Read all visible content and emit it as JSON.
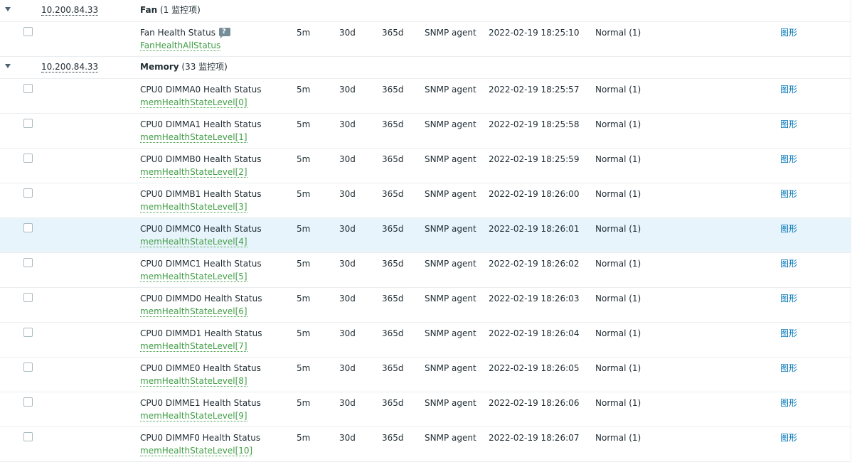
{
  "groups": [
    {
      "host": "10.200.84.33",
      "app_name": "Fan",
      "app_count": "(1 监控项)",
      "items": [
        {
          "name": "Fan Health Status",
          "help": true,
          "key": "FanHealthAllStatus",
          "interval": "5m",
          "history": "30d",
          "trends": "365d",
          "type": "SNMP agent",
          "last_check": "2022-02-19 18:25:10",
          "last_value": "Normal (1)",
          "graph": "图形"
        }
      ]
    },
    {
      "host": "10.200.84.33",
      "app_name": "Memory",
      "app_count": "(33 监控项)",
      "items": [
        {
          "name": "CPU0 DIMMA0 Health Status",
          "key": "memHealthStateLevel[0]",
          "interval": "5m",
          "history": "30d",
          "trends": "365d",
          "type": "SNMP agent",
          "last_check": "2022-02-19 18:25:57",
          "last_value": "Normal (1)",
          "graph": "图形"
        },
        {
          "name": "CPU0 DIMMA1 Health Status",
          "key": "memHealthStateLevel[1]",
          "interval": "5m",
          "history": "30d",
          "trends": "365d",
          "type": "SNMP agent",
          "last_check": "2022-02-19 18:25:58",
          "last_value": "Normal (1)",
          "graph": "图形"
        },
        {
          "name": "CPU0 DIMMB0 Health Status",
          "key": "memHealthStateLevel[2]",
          "interval": "5m",
          "history": "30d",
          "trends": "365d",
          "type": "SNMP agent",
          "last_check": "2022-02-19 18:25:59",
          "last_value": "Normal (1)",
          "graph": "图形"
        },
        {
          "name": "CPU0 DIMMB1 Health Status",
          "key": "memHealthStateLevel[3]",
          "interval": "5m",
          "history": "30d",
          "trends": "365d",
          "type": "SNMP agent",
          "last_check": "2022-02-19 18:26:00",
          "last_value": "Normal (1)",
          "graph": "图形"
        },
        {
          "name": "CPU0 DIMMC0 Health Status",
          "key": "memHealthStateLevel[4]",
          "interval": "5m",
          "history": "30d",
          "trends": "365d",
          "type": "SNMP agent",
          "last_check": "2022-02-19 18:26:01",
          "last_value": "Normal (1)",
          "graph": "图形",
          "hover": true
        },
        {
          "name": "CPU0 DIMMC1 Health Status",
          "key": "memHealthStateLevel[5]",
          "interval": "5m",
          "history": "30d",
          "trends": "365d",
          "type": "SNMP agent",
          "last_check": "2022-02-19 18:26:02",
          "last_value": "Normal (1)",
          "graph": "图形"
        },
        {
          "name": "CPU0 DIMMD0 Health Status",
          "key": "memHealthStateLevel[6]",
          "interval": "5m",
          "history": "30d",
          "trends": "365d",
          "type": "SNMP agent",
          "last_check": "2022-02-19 18:26:03",
          "last_value": "Normal (1)",
          "graph": "图形"
        },
        {
          "name": "CPU0 DIMMD1 Health Status",
          "key": "memHealthStateLevel[7]",
          "interval": "5m",
          "history": "30d",
          "trends": "365d",
          "type": "SNMP agent",
          "last_check": "2022-02-19 18:26:04",
          "last_value": "Normal (1)",
          "graph": "图形"
        },
        {
          "name": "CPU0 DIMME0 Health Status",
          "key": "memHealthStateLevel[8]",
          "interval": "5m",
          "history": "30d",
          "trends": "365d",
          "type": "SNMP agent",
          "last_check": "2022-02-19 18:26:05",
          "last_value": "Normal (1)",
          "graph": "图形"
        },
        {
          "name": "CPU0 DIMME1 Health Status",
          "key": "memHealthStateLevel[9]",
          "interval": "5m",
          "history": "30d",
          "trends": "365d",
          "type": "SNMP agent",
          "last_check": "2022-02-19 18:26:06",
          "last_value": "Normal (1)",
          "graph": "图形"
        },
        {
          "name": "CPU0 DIMMF0 Health Status",
          "key": "memHealthStateLevel[10]",
          "interval": "5m",
          "history": "30d",
          "trends": "365d",
          "type": "SNMP agent",
          "last_check": "2022-02-19 18:26:07",
          "last_value": "Normal (1)",
          "graph": "图形"
        }
      ]
    }
  ]
}
